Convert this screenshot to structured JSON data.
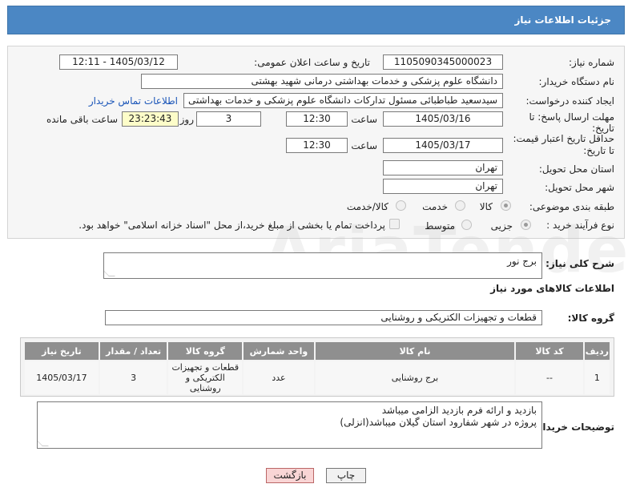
{
  "header": {
    "title": "جزئیات اطلاعات نیاز"
  },
  "form": {
    "need_number_label": "شماره نیاز:",
    "need_number": "1105090345000023",
    "announce_label": "تاریخ و ساعت اعلان عمومی:",
    "announce_value": "1405/03/12 - 12:11",
    "buyer_label": "نام دستگاه خریدار:",
    "buyer_value": "دانشگاه علوم پزشکی و خدمات بهداشتی درمانی شهید بهشتی",
    "creator_label": "ایجاد کننده درخواست:",
    "creator_value": "سیدسعید طباطبائی مسئول تدارکات دانشگاه علوم پزشکی و خدمات بهداشتی",
    "contact_link": "اطلاعات تماس خریدار",
    "deadline_label_1": "مهلت ارسال پاسخ: تا",
    "deadline_label_2": "تاریخ:",
    "deadline_date": "1405/03/16",
    "time_label": "ساعت",
    "deadline_time": "12:30",
    "days_value": "3",
    "days_label": "روز و",
    "remaining_time": "23:23:43",
    "remaining_label": "ساعت باقی مانده",
    "validity_label_1": "حداقل تاریخ اعتبار قیمت:",
    "validity_label_2": "تا تاریخ:",
    "validity_date": "1405/03/17",
    "validity_time": "12:30",
    "province_label": "استان محل تحویل:",
    "province_value": "تهران",
    "city_label": "شهر محل تحویل:",
    "city_value": "تهران",
    "category_label": "طبقه بندی موضوعی:",
    "category_options": [
      "کالا",
      "خدمت",
      "کالا/خدمت"
    ],
    "category_selected": "کالا",
    "process_label": "نوع فرآیند خرید :",
    "process_options": [
      "جزیی",
      "متوسط"
    ],
    "process_selected": "جزیی",
    "payment_note": "پرداخت تمام یا بخشی از مبلغ خرید،از محل \"اسناد خزانه اسلامی\" خواهد بود."
  },
  "description": {
    "label": "شرح کلی نیاز:",
    "value": "برج نور"
  },
  "goods_info_title": "اطلاعات کالاهای مورد نیاز",
  "goods_group": {
    "label": "گروه کالا:",
    "value": "قطعات و تجهیزات الکتریکی و روشنایی"
  },
  "table": {
    "headers": [
      "ردیف",
      "کد کالا",
      "نام کالا",
      "واحد شمارش",
      "گروه کالا",
      "تعداد / مقدار",
      "تاریخ نیاز"
    ],
    "rows": [
      [
        "1",
        "--",
        "برج روشنایی",
        "عدد",
        "قطعات و تجهیزات الکتریکی و روشنایی",
        "3",
        "1405/03/17"
      ]
    ]
  },
  "buyer_notes": {
    "label": "توضیحات خریدار:",
    "line1": "بازدید و ارائه فرم بازدید الزامی میباشد",
    "line2": "پروژه در شهر شفارود استان گیلان میباشد(انزلی)"
  },
  "buttons": {
    "print": "چاپ",
    "back": "بازگشت"
  },
  "watermark": "AriaTender.net",
  "colors": {
    "header": "#4b87c4",
    "link": "#1a55b8",
    "table_header": "#8f8f8f"
  }
}
